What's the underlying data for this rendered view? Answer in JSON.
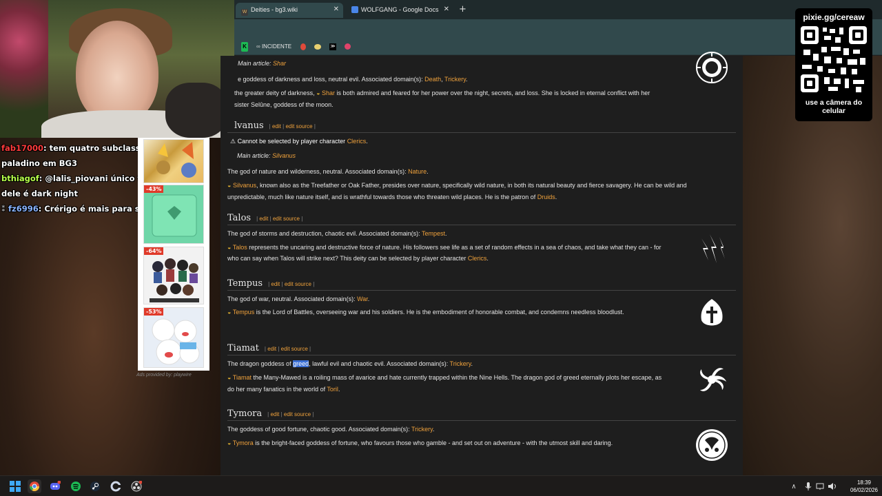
{
  "chat": [
    {
      "user": "fab17000",
      "text": "tem quatro subclasses de"
    },
    {
      "user": "",
      "text": "paladino em BG3"
    },
    {
      "user": "bthiagof",
      "text": "@lalis_piovani único filme bom"
    },
    {
      "user": "",
      "text": "dele é dark night"
    },
    {
      "user": "fz6996",
      "text": "Crérigo é mais para suporte"
    }
  ],
  "ads": {
    "badges": [
      "-43%",
      "-64%",
      "-53%"
    ],
    "footer": "Ads provided by: playwire"
  },
  "browser": {
    "tabs": [
      {
        "label": "Deities - bg3.wiki",
        "active": true
      },
      {
        "label": "WOLFGANG - Google Docs",
        "active": false
      }
    ],
    "new_tab": "+",
    "bookmark_label": "INCIDENTE"
  },
  "page": {
    "shar": {
      "main_article_prefix": "Main article: ",
      "main_article_link": "Shar",
      "desc_pre": "e goddess of darkness and loss, neutral evil. Associated domain(s): ",
      "domain1": "Death",
      "sep": ", ",
      "domain2": "Trickery",
      "end": ".",
      "lore_pre": " the greater deity of darkness, ",
      "lore_name": "Shar",
      "lore_post": " is both admired and feared for her power over the night, secrets, and loss. She is locked in eternal conflict with her",
      "lore_line2": "sister Selûne, goddess of the moon."
    },
    "silvanus": {
      "heading": "lvanus",
      "warning_pre": "Cannot be selected by player character ",
      "warning_link": "Clerics",
      "warning_end": ".",
      "main_article_prefix": "Main article: ",
      "main_article_link": "Silvanus",
      "desc_pre": "The god of nature and wilderness, neutral. Associated domain(s): ",
      "domain": "Nature",
      "end": ".",
      "lore_name": "Silvanus",
      "lore_post": ", known also as the Treefather or Oak Father, presides over nature, specifically wild nature, in both its natural beauty and fierce savagery. He can be wild and",
      "lore_line2_pre": "unpredictable, much like nature itself, and is wrathful towards those who threaten wild places. He is the patron of ",
      "lore_line2_link": "Druids",
      "lore_line2_end": "."
    },
    "talos": {
      "heading": "Talos",
      "desc_pre": "The god of storms and destruction, chaotic evil. Associated domain(s): ",
      "domain": "Tempest",
      "end": ".",
      "lore_name": "Talos",
      "lore_post": " represents the uncaring and destructive force of nature. His followers see life as a set of random effects in a sea of chaos, and take what they can - for",
      "lore_line2_pre": "who can say when Talos will strike next? This deity can be selected by player character ",
      "lore_line2_link": "Clerics",
      "lore_line2_end": "."
    },
    "tempus": {
      "heading": "Tempus",
      "desc_pre": "The god of war, neutral. Associated domain(s): ",
      "domain": "War",
      "end": ".",
      "lore_name": "Tempus",
      "lore_post": " is the Lord of Battles, overseeing war and his soldiers. He is the embodiment of honorable combat, and condemns needless bloodlust."
    },
    "tiamat": {
      "heading": "Tiamat",
      "desc_pre": "The dragon goddess of ",
      "desc_sel": "greed",
      "desc_post": ", lawful evil and chaotic evil. Associated domain(s): ",
      "domain": "Trickery",
      "end": ".",
      "lore_name": "Tiamat",
      "lore_post": " the Many-Mawed is a roiling mass of avarice and hate currently trapped within the Nine Hells. The dragon god of greed eternally plots her escape, as",
      "lore_line2_pre": "do her many fanatics in the world of ",
      "lore_line2_link": "Toril",
      "lore_line2_end": "."
    },
    "tymora": {
      "heading": "Tymora",
      "desc_pre": "The goddess of good fortune, chaotic good. Associated domain(s): ",
      "domain": "Trickery",
      "end": ".",
      "lore_name": "Tymora",
      "lore_post": " is the bright-faced goddess of fortune, who favours those who gamble - and set out on adventure - with the utmost skill and daring."
    },
    "edit": "edit",
    "edit_source": "edit source",
    "bar": "|"
  },
  "qr": {
    "title": "pixie.gg/cereaw",
    "subtitle": "use a câmera do celular"
  },
  "taskbar": {
    "time": "18:39",
    "date": "06/02/2026"
  }
}
